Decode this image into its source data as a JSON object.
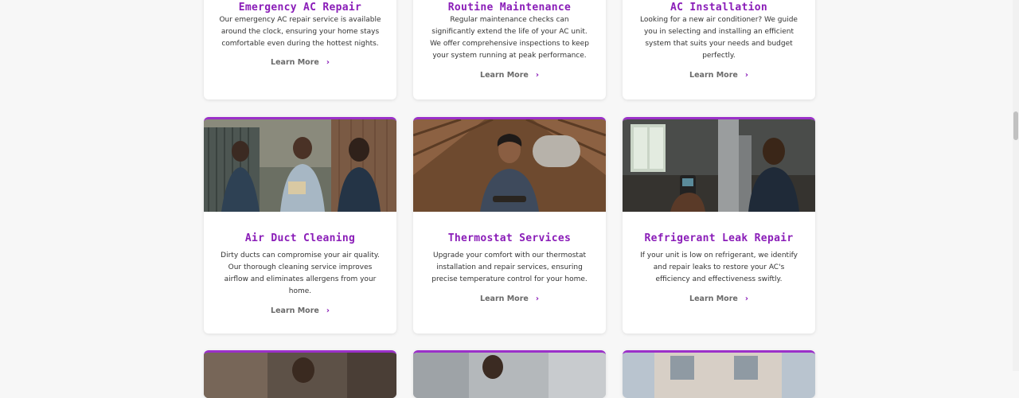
{
  "cards": [
    {
      "title": "Emergency AC Repair",
      "text": "Our emergency AC repair service is available around the clock, ensuring your home stays comfortable even during the hottest nights.",
      "link": "Learn More"
    },
    {
      "title": "Routine Maintenance",
      "text": "Regular maintenance checks can significantly extend the life of your AC unit. We offer comprehensive inspections to keep your system running at peak performance.",
      "link": "Learn More"
    },
    {
      "title": "AC Installation",
      "text": "Looking for a new air conditioner? We guide you in selecting and installing an efficient system that suits your needs and budget perfectly.",
      "link": "Learn More"
    },
    {
      "title": "Air Duct Cleaning",
      "text": "Dirty ducts can compromise your air quality. Our thorough cleaning service improves airflow and eliminates allergens from your home.",
      "link": "Learn More"
    },
    {
      "title": "Thermostat Services",
      "text": "Upgrade your comfort with our thermostat installation and repair services, ensuring precise temperature control for your home.",
      "link": "Learn More"
    },
    {
      "title": "Refrigerant Leak Repair",
      "text": "If your unit is low on refrigerant, we identify and repair leaks to restore your AC's efficiency and effectiveness swiftly.",
      "link": "Learn More"
    }
  ],
  "icons": {
    "chevron": "chevron-right-icon"
  },
  "colors": {
    "accent": "#8a1db8",
    "border_accent": "#9b30c9",
    "text": "#333333",
    "link": "#6a6a6a"
  }
}
